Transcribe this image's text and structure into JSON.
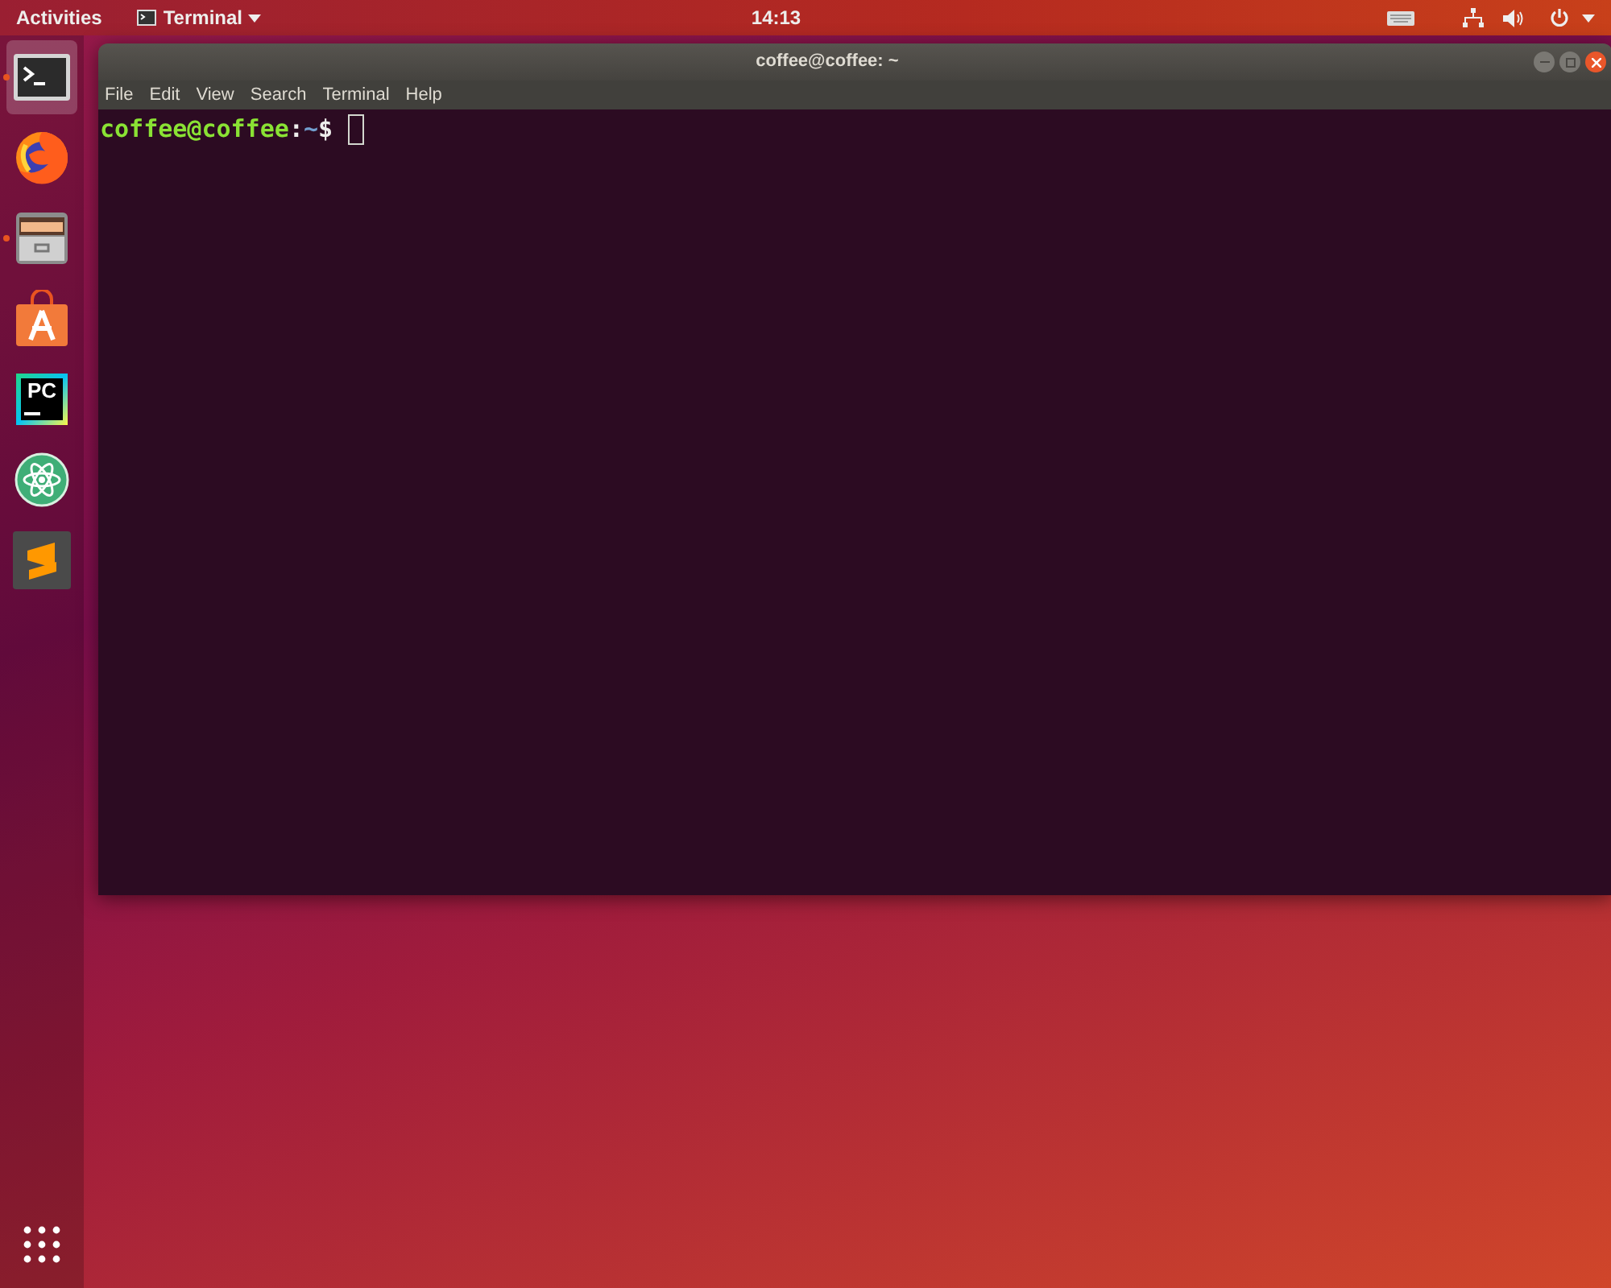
{
  "top_bar": {
    "activities": "Activities",
    "app_menu": "Terminal",
    "clock": "14:13"
  },
  "dock": {
    "items": [
      {
        "kind": "terminal",
        "selected": true,
        "running": true
      },
      {
        "kind": "firefox",
        "selected": false,
        "running": false
      },
      {
        "kind": "files",
        "selected": false,
        "running": true
      },
      {
        "kind": "software",
        "selected": false,
        "running": false
      },
      {
        "kind": "pycharm",
        "selected": false,
        "running": false,
        "label": "PC"
      },
      {
        "kind": "atom",
        "selected": false,
        "running": false
      },
      {
        "kind": "sublime",
        "selected": false,
        "running": false
      }
    ]
  },
  "window": {
    "title": "coffee@coffee: ~",
    "menu": [
      "File",
      "Edit",
      "View",
      "Search",
      "Terminal",
      "Help"
    ],
    "prompt": {
      "user_host": "coffee@coffee",
      "separator": ":",
      "path": "~",
      "symbol": "$"
    }
  }
}
